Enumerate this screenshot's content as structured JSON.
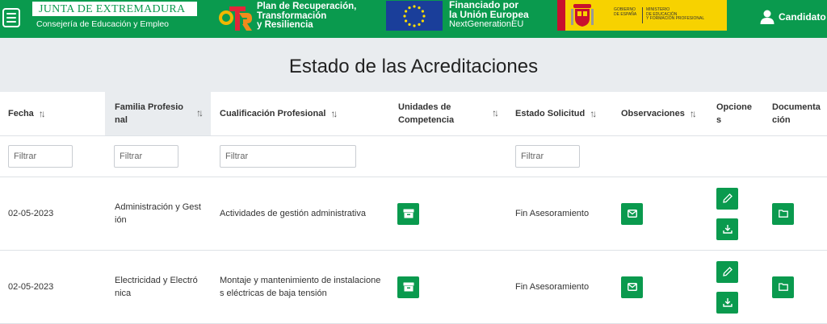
{
  "header": {
    "junta_title": "JUNTA DE EXTREMADURA",
    "junta_subtitle": "Consejería de Educación y Empleo",
    "prtr_line1": "Plan de Recuperación,",
    "prtr_line2": "Transformación",
    "prtr_line3": "y Resiliencia",
    "eu_line1": "Financiado por",
    "eu_line2": "la Unión Europea",
    "eu_line3": "NextGenerationEU",
    "gob_text": "GOBIERNO\nDE ESPAÑA",
    "ministry_text": "MINISTERIO\nDE EDUCACIÓN\nY FORMACIÓN PROFESIONAL",
    "user_label": "Candidato",
    "accent": "#0a9a4e"
  },
  "page": {
    "title": "Estado de las Acreditaciones"
  },
  "table": {
    "columns": {
      "fecha": "Fecha",
      "familia": "Familia Profesional",
      "cualificacion": "Cualificación Profesional",
      "unidades": "Unidades de Competencia",
      "estado": "Estado Solicitud",
      "observaciones": "Observaciones",
      "opciones": "Opciones",
      "documentacion": "Documentación"
    },
    "filter_placeholder": "Filtrar",
    "rows": [
      {
        "fecha": "02-05-2023",
        "familia": "Administración y Gestión",
        "cualificacion": "Actividades de gestión administrativa",
        "estado": "Fin Asesoramiento"
      },
      {
        "fecha": "02-05-2023",
        "familia": "Electricidad y Electrónica",
        "cualificacion": "Montaje y mantenimiento de instalaciones eléctricas de baja tensión",
        "estado": "Fin Asesoramiento"
      }
    ]
  }
}
